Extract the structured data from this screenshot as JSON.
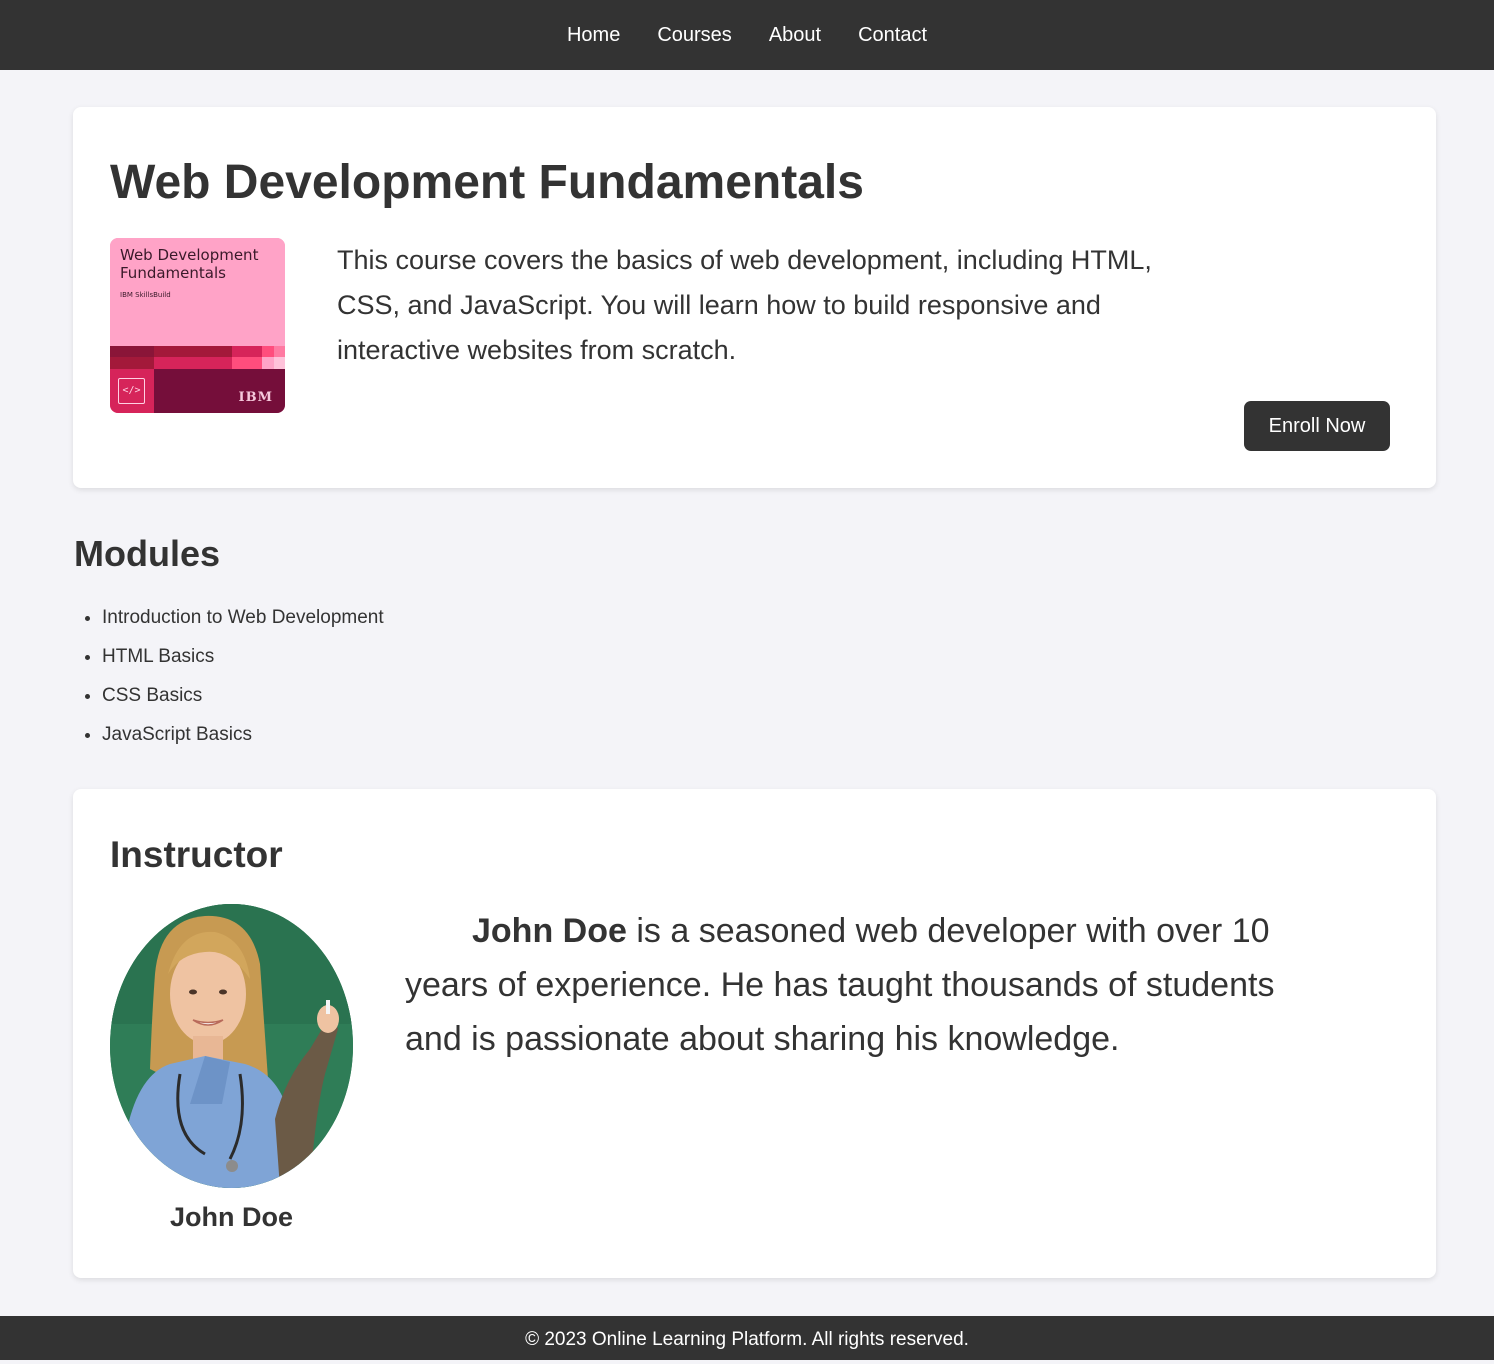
{
  "nav": {
    "items": [
      "Home",
      "Courses",
      "About",
      "Contact"
    ]
  },
  "course": {
    "title": "Web Development Fundamentals",
    "cover": {
      "title": "Web Development Fundamentals",
      "brand": "IBM SkillsBuild",
      "logo": "IBM",
      "icon": "code-icon"
    },
    "description": "This course covers the basics of web development, including HTML, CSS, and JavaScript. You will learn how to build responsive and interactive websites from scratch.",
    "enroll_label": "Enroll Now"
  },
  "modules": {
    "title": "Modules",
    "items": [
      "Introduction to Web Development",
      "HTML Basics",
      "CSS Basics",
      "JavaScript Basics"
    ]
  },
  "instructor": {
    "title": "Instructor",
    "name": "John Doe",
    "bio_name": "John Doe",
    "bio_rest": " is a seasoned web developer with over 10 years of experience. He has taught thousands of students and is passionate about sharing his knowledge."
  },
  "footer": {
    "text": "© 2023 Online Learning Platform. All rights reserved."
  }
}
